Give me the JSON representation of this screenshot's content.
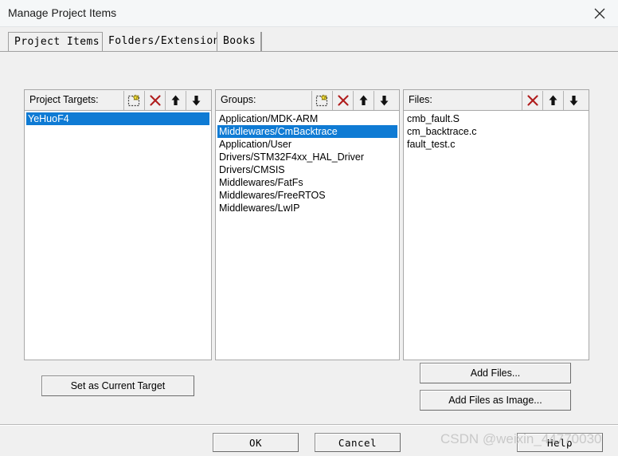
{
  "window": {
    "title": "Manage Project Items",
    "close_icon": "close-icon"
  },
  "tabs": [
    {
      "label": "Project Items",
      "active": true
    },
    {
      "label": "Folders/Extensions",
      "active": false
    },
    {
      "label": "Books",
      "active": false
    }
  ],
  "panels": {
    "targets": {
      "label": "Project Targets:",
      "buttons": [
        {
          "icon": "new-item-icon",
          "name": "new-target-button"
        },
        {
          "icon": "delete-x-icon",
          "name": "delete-target-button"
        },
        {
          "icon": "arrow-up-icon",
          "name": "move-target-up-button"
        },
        {
          "icon": "arrow-down-icon",
          "name": "move-target-down-button"
        }
      ],
      "items": [
        {
          "label": "YeHuoF4",
          "selected": true
        }
      ]
    },
    "groups": {
      "label": "Groups:",
      "buttons": [
        {
          "icon": "new-item-icon",
          "name": "new-group-button"
        },
        {
          "icon": "delete-x-icon",
          "name": "delete-group-button"
        },
        {
          "icon": "arrow-up-icon",
          "name": "move-group-up-button"
        },
        {
          "icon": "arrow-down-icon",
          "name": "move-group-down-button"
        }
      ],
      "items": [
        {
          "label": "Application/MDK-ARM",
          "selected": false
        },
        {
          "label": "Middlewares/CmBacktrace",
          "selected": true
        },
        {
          "label": "Application/User",
          "selected": false
        },
        {
          "label": "Drivers/STM32F4xx_HAL_Driver",
          "selected": false
        },
        {
          "label": "Drivers/CMSIS",
          "selected": false
        },
        {
          "label": "Middlewares/FatFs",
          "selected": false
        },
        {
          "label": "Middlewares/FreeRTOS",
          "selected": false
        },
        {
          "label": "Middlewares/LwIP",
          "selected": false
        }
      ]
    },
    "files": {
      "label": "Files:",
      "buttons": [
        {
          "icon": "delete-x-icon",
          "name": "delete-file-button"
        },
        {
          "icon": "arrow-up-icon",
          "name": "move-file-up-button"
        },
        {
          "icon": "arrow-down-icon",
          "name": "move-file-down-button"
        }
      ],
      "items": [
        {
          "label": "cmb_fault.S",
          "selected": false
        },
        {
          "label": "cm_backtrace.c",
          "selected": false
        },
        {
          "label": "fault_test.c",
          "selected": false
        }
      ]
    }
  },
  "actions": {
    "set_as_current_target": "Set as Current Target",
    "add_files": "Add Files...",
    "add_files_as_image": "Add Files as Image..."
  },
  "footer": {
    "ok": "OK",
    "cancel": "Cancel",
    "help": "Help"
  },
  "watermark": {
    "text": "CSDN @weixin_44770030"
  },
  "colors": {
    "selection_blue": "#0f7bd4",
    "dialog_face": "#f0f0f0",
    "titlebar": "#f5f7f8",
    "delete_red": "#b01c1c"
  }
}
